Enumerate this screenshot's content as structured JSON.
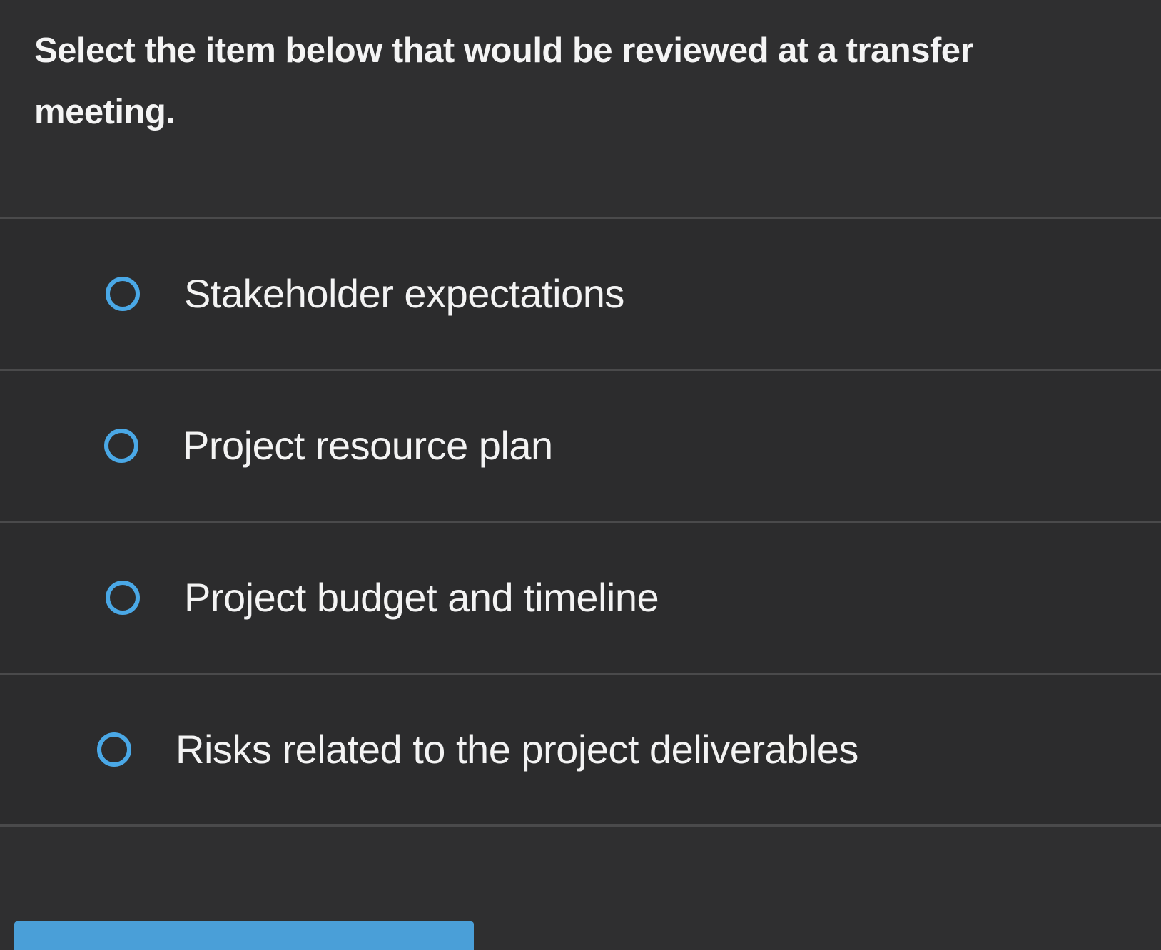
{
  "question": {
    "text": "Select the item below that would be reviewed at a transfer meeting."
  },
  "options": [
    {
      "label": "Stakeholder expectations",
      "selected": false
    },
    {
      "label": "Project resource plan",
      "selected": false
    },
    {
      "label": "Project budget and timeline",
      "selected": false
    },
    {
      "label": "Risks related to the project deliverables",
      "selected": false
    }
  ],
  "colors": {
    "background": "#2f2f30",
    "accent": "#4aa8e6",
    "divider": "#4a4a4b"
  }
}
